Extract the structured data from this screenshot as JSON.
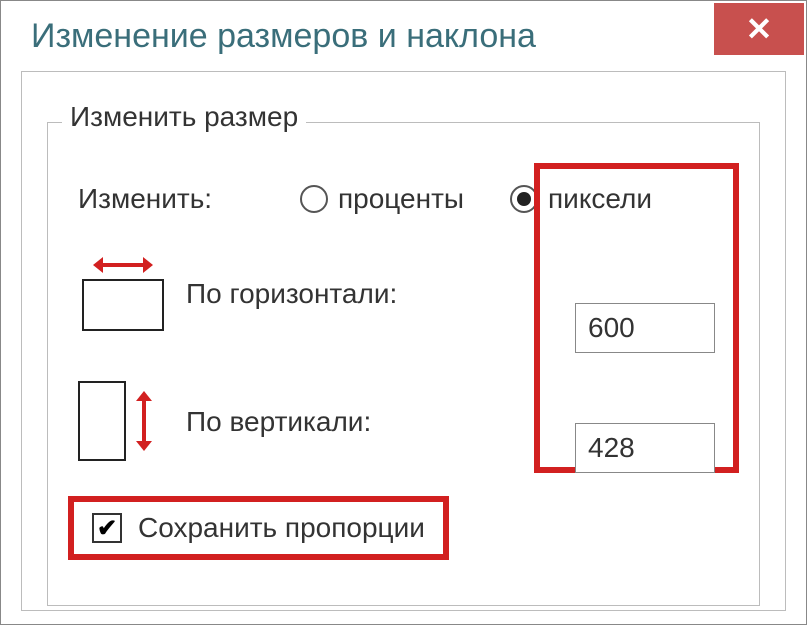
{
  "window": {
    "title": "Изменение размеров и наклона"
  },
  "resize": {
    "legend": "Изменить размер",
    "change_label": "Изменить:",
    "radio_percent": "проценты",
    "radio_pixels": "пиксели",
    "horizontal_label": "По горизонтали:",
    "vertical_label": "По вертикали:",
    "horizontal_value": "600",
    "vertical_value": "428",
    "keep_proportions": "Сохранить пропорции"
  },
  "colors": {
    "highlight": "#d22020",
    "close_bg": "#c8504e",
    "title_fg": "#3a6e7a"
  }
}
